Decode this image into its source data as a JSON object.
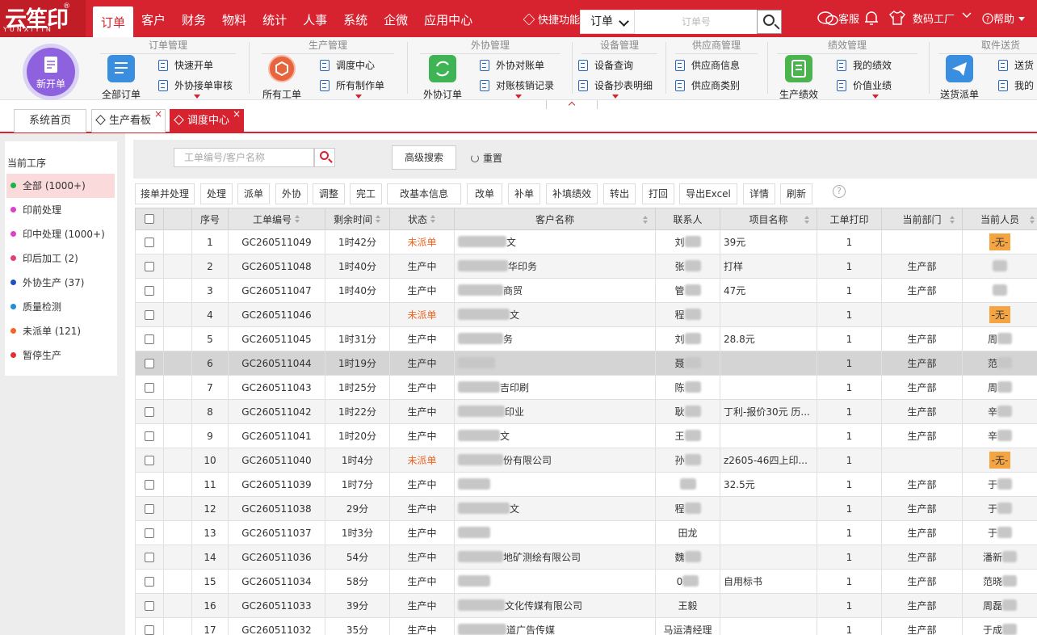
{
  "brand": {
    "logo_text": "云笙印",
    "logo_sub": "YUNXIYIN",
    "reg": "®"
  },
  "nav": [
    "订单",
    "客户",
    "财务",
    "物料",
    "统计",
    "人事",
    "系统",
    "企微",
    "应用中心"
  ],
  "quick_label": "快捷功能",
  "search": {
    "type": "订单",
    "placeholder": "订单号"
  },
  "header_right": {
    "service": "客服",
    "company": "数码工厂",
    "help": "帮助"
  },
  "ribbon": {
    "new_order": "新开单",
    "groups": [
      {
        "title": "订单管理",
        "big": "全部订单",
        "small": [
          "快速开单",
          "外协接单审核"
        ]
      },
      {
        "title": "生产管理",
        "big": "所有工单",
        "small": [
          "调度中心",
          "所有制作单"
        ]
      },
      {
        "title": "外协管理",
        "big": "外协订单",
        "small": [
          "外协对账单",
          "对账核销记录"
        ]
      },
      {
        "title": "设备管理",
        "small": [
          "设备查询",
          "设备抄表明细"
        ]
      },
      {
        "title": "供应商管理",
        "small": [
          "供应商信息",
          "供应商类别"
        ]
      },
      {
        "title": "绩效管理",
        "big": "生产绩效",
        "small": [
          "我的绩效",
          "价值业绩"
        ]
      },
      {
        "title": "取件送货",
        "big": "送货派单",
        "small": [
          "送货",
          "我的"
        ]
      }
    ]
  },
  "tabs": [
    "系统首页",
    "生产看板",
    "调度中心"
  ],
  "sidebar": {
    "title": "当前工序",
    "items": [
      {
        "label": "全部 (1000+)",
        "color": "#1ab34a"
      },
      {
        "label": "印前处理",
        "color": "#e040c8"
      },
      {
        "label": "印中处理 (1000+)",
        "color": "#e040c8"
      },
      {
        "label": "印后加工 (2)",
        "color": "#e0407a"
      },
      {
        "label": "外协生产 (37)",
        "color": "#1f4fc8"
      },
      {
        "label": "质量检测",
        "color": "#1f8fd8"
      },
      {
        "label": "未派单 (121)",
        "color": "#f26522"
      },
      {
        "label": "暂停生产",
        "color": "#e0303a"
      }
    ]
  },
  "filter": {
    "placeholder": "工单编号/客户名称",
    "advanced": "高级搜索",
    "reset": "重置"
  },
  "actions": [
    "接单并处理",
    "处理",
    "派单",
    "外协",
    "调整",
    "完工",
    "改基本信息",
    "改单",
    "补单",
    "补填绩效",
    "转出",
    "打回",
    "导出Excel",
    "详情",
    "刷新"
  ],
  "help_icon": "?",
  "columns": [
    "序号",
    "工单编号",
    "剩余时间",
    "状态",
    "客户名称",
    "联系人",
    "项目名称",
    "工单打印",
    "当前部门",
    "当前人员"
  ],
  "rows": [
    {
      "no": "1",
      "code": "GC260511049",
      "time": "1时42分",
      "status": "未派单",
      "cust": "文",
      "contact": "刘",
      "proj": "39元",
      "print": "1",
      "dept": "",
      "person": "-无-"
    },
    {
      "no": "2",
      "code": "GC260511048",
      "time": "1时40分",
      "status": "生产中",
      "cust": "华印务",
      "contact": "张",
      "proj": "打样",
      "print": "1",
      "dept": "生产部",
      "person": ""
    },
    {
      "no": "3",
      "code": "GC260511047",
      "time": "1时40分",
      "status": "生产中",
      "cust": "商贸",
      "contact": "管",
      "proj": "47元",
      "print": "1",
      "dept": "生产部",
      "person": ""
    },
    {
      "no": "4",
      "code": "GC260511046",
      "time": "",
      "status": "未派单",
      "cust": "文",
      "contact": "程",
      "proj": "",
      "print": "1",
      "dept": "",
      "person": "-无-"
    },
    {
      "no": "5",
      "code": "GC260511045",
      "time": "1时31分",
      "status": "生产中",
      "cust": "务",
      "contact": "刘",
      "proj": "28.8元",
      "print": "1",
      "dept": "生产部",
      "person": "周"
    },
    {
      "no": "6",
      "code": "GC260511044",
      "time": "1时19分",
      "status": "生产中",
      "cust": "",
      "contact": "聂",
      "proj": "",
      "print": "1",
      "dept": "生产部",
      "person": "范"
    },
    {
      "no": "7",
      "code": "GC260511043",
      "time": "1时25分",
      "status": "生产中",
      "cust": "吉印刷",
      "contact": "陈",
      "proj": "",
      "print": "1",
      "dept": "生产部",
      "person": "周"
    },
    {
      "no": "8",
      "code": "GC260511042",
      "time": "1时22分",
      "status": "生产中",
      "cust": "印业",
      "contact": "耿",
      "proj": "丁利-报价30元 历...",
      "print": "1",
      "dept": "生产部",
      "person": "辛"
    },
    {
      "no": "9",
      "code": "GC260511041",
      "time": "1时20分",
      "status": "生产中",
      "cust": "文",
      "contact": "王",
      "proj": "",
      "print": "1",
      "dept": "生产部",
      "person": "辛"
    },
    {
      "no": "10",
      "code": "GC260511040",
      "time": "1时4分",
      "status": "未派单",
      "cust": "份有限公司",
      "contact": "孙",
      "proj": "z2605-46四上印...",
      "print": "1",
      "dept": "",
      "person": "-无-"
    },
    {
      "no": "11",
      "code": "GC260511039",
      "time": "1时7分",
      "status": "生产中",
      "cust": "",
      "contact": "",
      "proj": "32.5元",
      "print": "1",
      "dept": "生产部",
      "person": "于"
    },
    {
      "no": "12",
      "code": "GC260511038",
      "time": "29分",
      "status": "生产中",
      "cust": "文",
      "contact": "程",
      "proj": "",
      "print": "1",
      "dept": "生产部",
      "person": "于"
    },
    {
      "no": "13",
      "code": "GC260511037",
      "time": "1时3分",
      "status": "生产中",
      "cust": "",
      "contact": "田龙",
      "proj": "",
      "print": "1",
      "dept": "生产部",
      "person": "于"
    },
    {
      "no": "14",
      "code": "GC260511036",
      "time": "54分",
      "status": "生产中",
      "cust": "地矿测绘有限公司",
      "contact": "魏",
      "proj": "",
      "print": "1",
      "dept": "生产部",
      "person": "潘新"
    },
    {
      "no": "15",
      "code": "GC260511034",
      "time": "58分",
      "status": "生产中",
      "cust": "",
      "contact": "0",
      "proj": "自用标书",
      "print": "1",
      "dept": "生产部",
      "person": "范晓"
    },
    {
      "no": "16",
      "code": "GC260511033",
      "time": "39分",
      "status": "生产中",
      "cust": "文化传媒有限公司",
      "contact": "王毅",
      "proj": "",
      "print": "1",
      "dept": "生产部",
      "person": "周磊"
    },
    {
      "no": "17",
      "code": "GC260511032",
      "time": "35分",
      "status": "生产中",
      "cust": "道广告传媒",
      "contact": "马运清经理",
      "proj": "",
      "print": "1",
      "dept": "生产部",
      "person": "于成"
    }
  ],
  "colors": {
    "brand_red": "#d6232f",
    "new_order_purple": "#8e62de",
    "pending_orange": "#f26522",
    "none_badge": "#f5a442"
  }
}
